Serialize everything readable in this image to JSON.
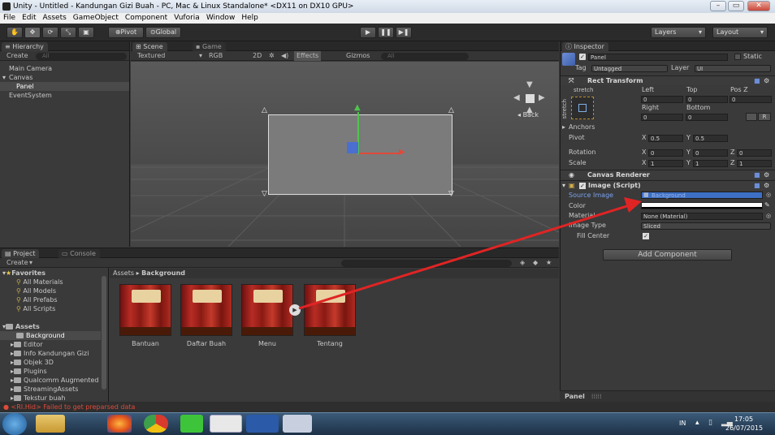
{
  "window": {
    "title": "Unity - Untitled - Kandungan Gizi Buah - PC, Mac & Linux Standalone* <DX11 on DX10 GPU>",
    "minimize": "–",
    "maximize": "▭",
    "close": "✕"
  },
  "menu": [
    "File",
    "Edit",
    "Assets",
    "GameObject",
    "Component",
    "Vuforia",
    "Window",
    "Help"
  ],
  "toolbar": {
    "pivot": "Pivot",
    "global": "Global",
    "layers": "Layers",
    "layout": "Layout"
  },
  "hierarchy": {
    "tab": "Hierarchy",
    "create": "Create",
    "search_placeholder": "All",
    "items": [
      "Main Camera",
      "Canvas",
      "Panel",
      "EventSystem"
    ]
  },
  "scene": {
    "tab_scene": "Scene",
    "tab_game": "Game",
    "shading": "Textured",
    "render": "RGB",
    "mode2d": "2D",
    "effects": "Effects",
    "gizmos": "Gizmos",
    "search_placeholder": "All",
    "back_label": "Back"
  },
  "inspector": {
    "tab": "Inspector",
    "object_name": "Panel",
    "static_label": "Static",
    "tag_label": "Tag",
    "tag_value": "Untagged",
    "layer_label": "Layer",
    "layer_value": "UI",
    "rect_transform": {
      "title": "Rect Transform",
      "stretch": "stretch",
      "left_label": "Left",
      "left": "0",
      "top_label": "Top",
      "top": "0",
      "posz_label": "Pos Z",
      "posz": "0",
      "right_label": "Right",
      "right": "0",
      "bottom_label": "Bottom",
      "bottom": "0",
      "anchors": "Anchors",
      "pivot_label": "Pivot",
      "pivot_x": "0.5",
      "pivot_y": "0.5",
      "rotation_label": "Rotation",
      "rot_x": "0",
      "rot_y": "0",
      "rot_z": "0",
      "scale_label": "Scale",
      "scale_x": "1",
      "scale_y": "1",
      "scale_z": "1",
      "raw_btn": "R"
    },
    "canvas_renderer": "Canvas Renderer",
    "image_script": {
      "title": "Image (Script)",
      "source_image_label": "Source Image",
      "source_image_value": "Background",
      "color_label": "Color",
      "material_label": "Material",
      "material_value": "None (Material)",
      "image_type_label": "Image Type",
      "image_type_value": "Sliced",
      "fill_center_label": "Fill Center"
    },
    "add_component": "Add Component",
    "footer": "Panel"
  },
  "project": {
    "tab_project": "Project",
    "tab_console": "Console",
    "create": "Create",
    "favorites_label": "Favorites",
    "favorites": [
      "All Materials",
      "All Models",
      "All Prefabs",
      "All Scripts"
    ],
    "assets_label": "Assets",
    "folders": [
      "Background",
      "Editor",
      "Info Kandungan Gizi",
      "Objek 3D",
      "Plugins",
      "Qualcomm Augmented",
      "StreamingAssets",
      "Tekstur buah"
    ],
    "breadcrumb_root": "Assets",
    "breadcrumb_current": "Background",
    "thumbnails": [
      "Bantuan",
      "Daftar Buah",
      "Menu",
      "Tentang"
    ]
  },
  "status": {
    "error": "<RI.Hid> Failed to get preparsed data"
  },
  "taskbar": {
    "lang": "IN",
    "time": "17:05",
    "date": "26/07/2015"
  },
  "colors": {
    "arrow": "#e02424",
    "source_highlight": "#3d6fc4",
    "panel_rect": "#7b7b7b"
  }
}
